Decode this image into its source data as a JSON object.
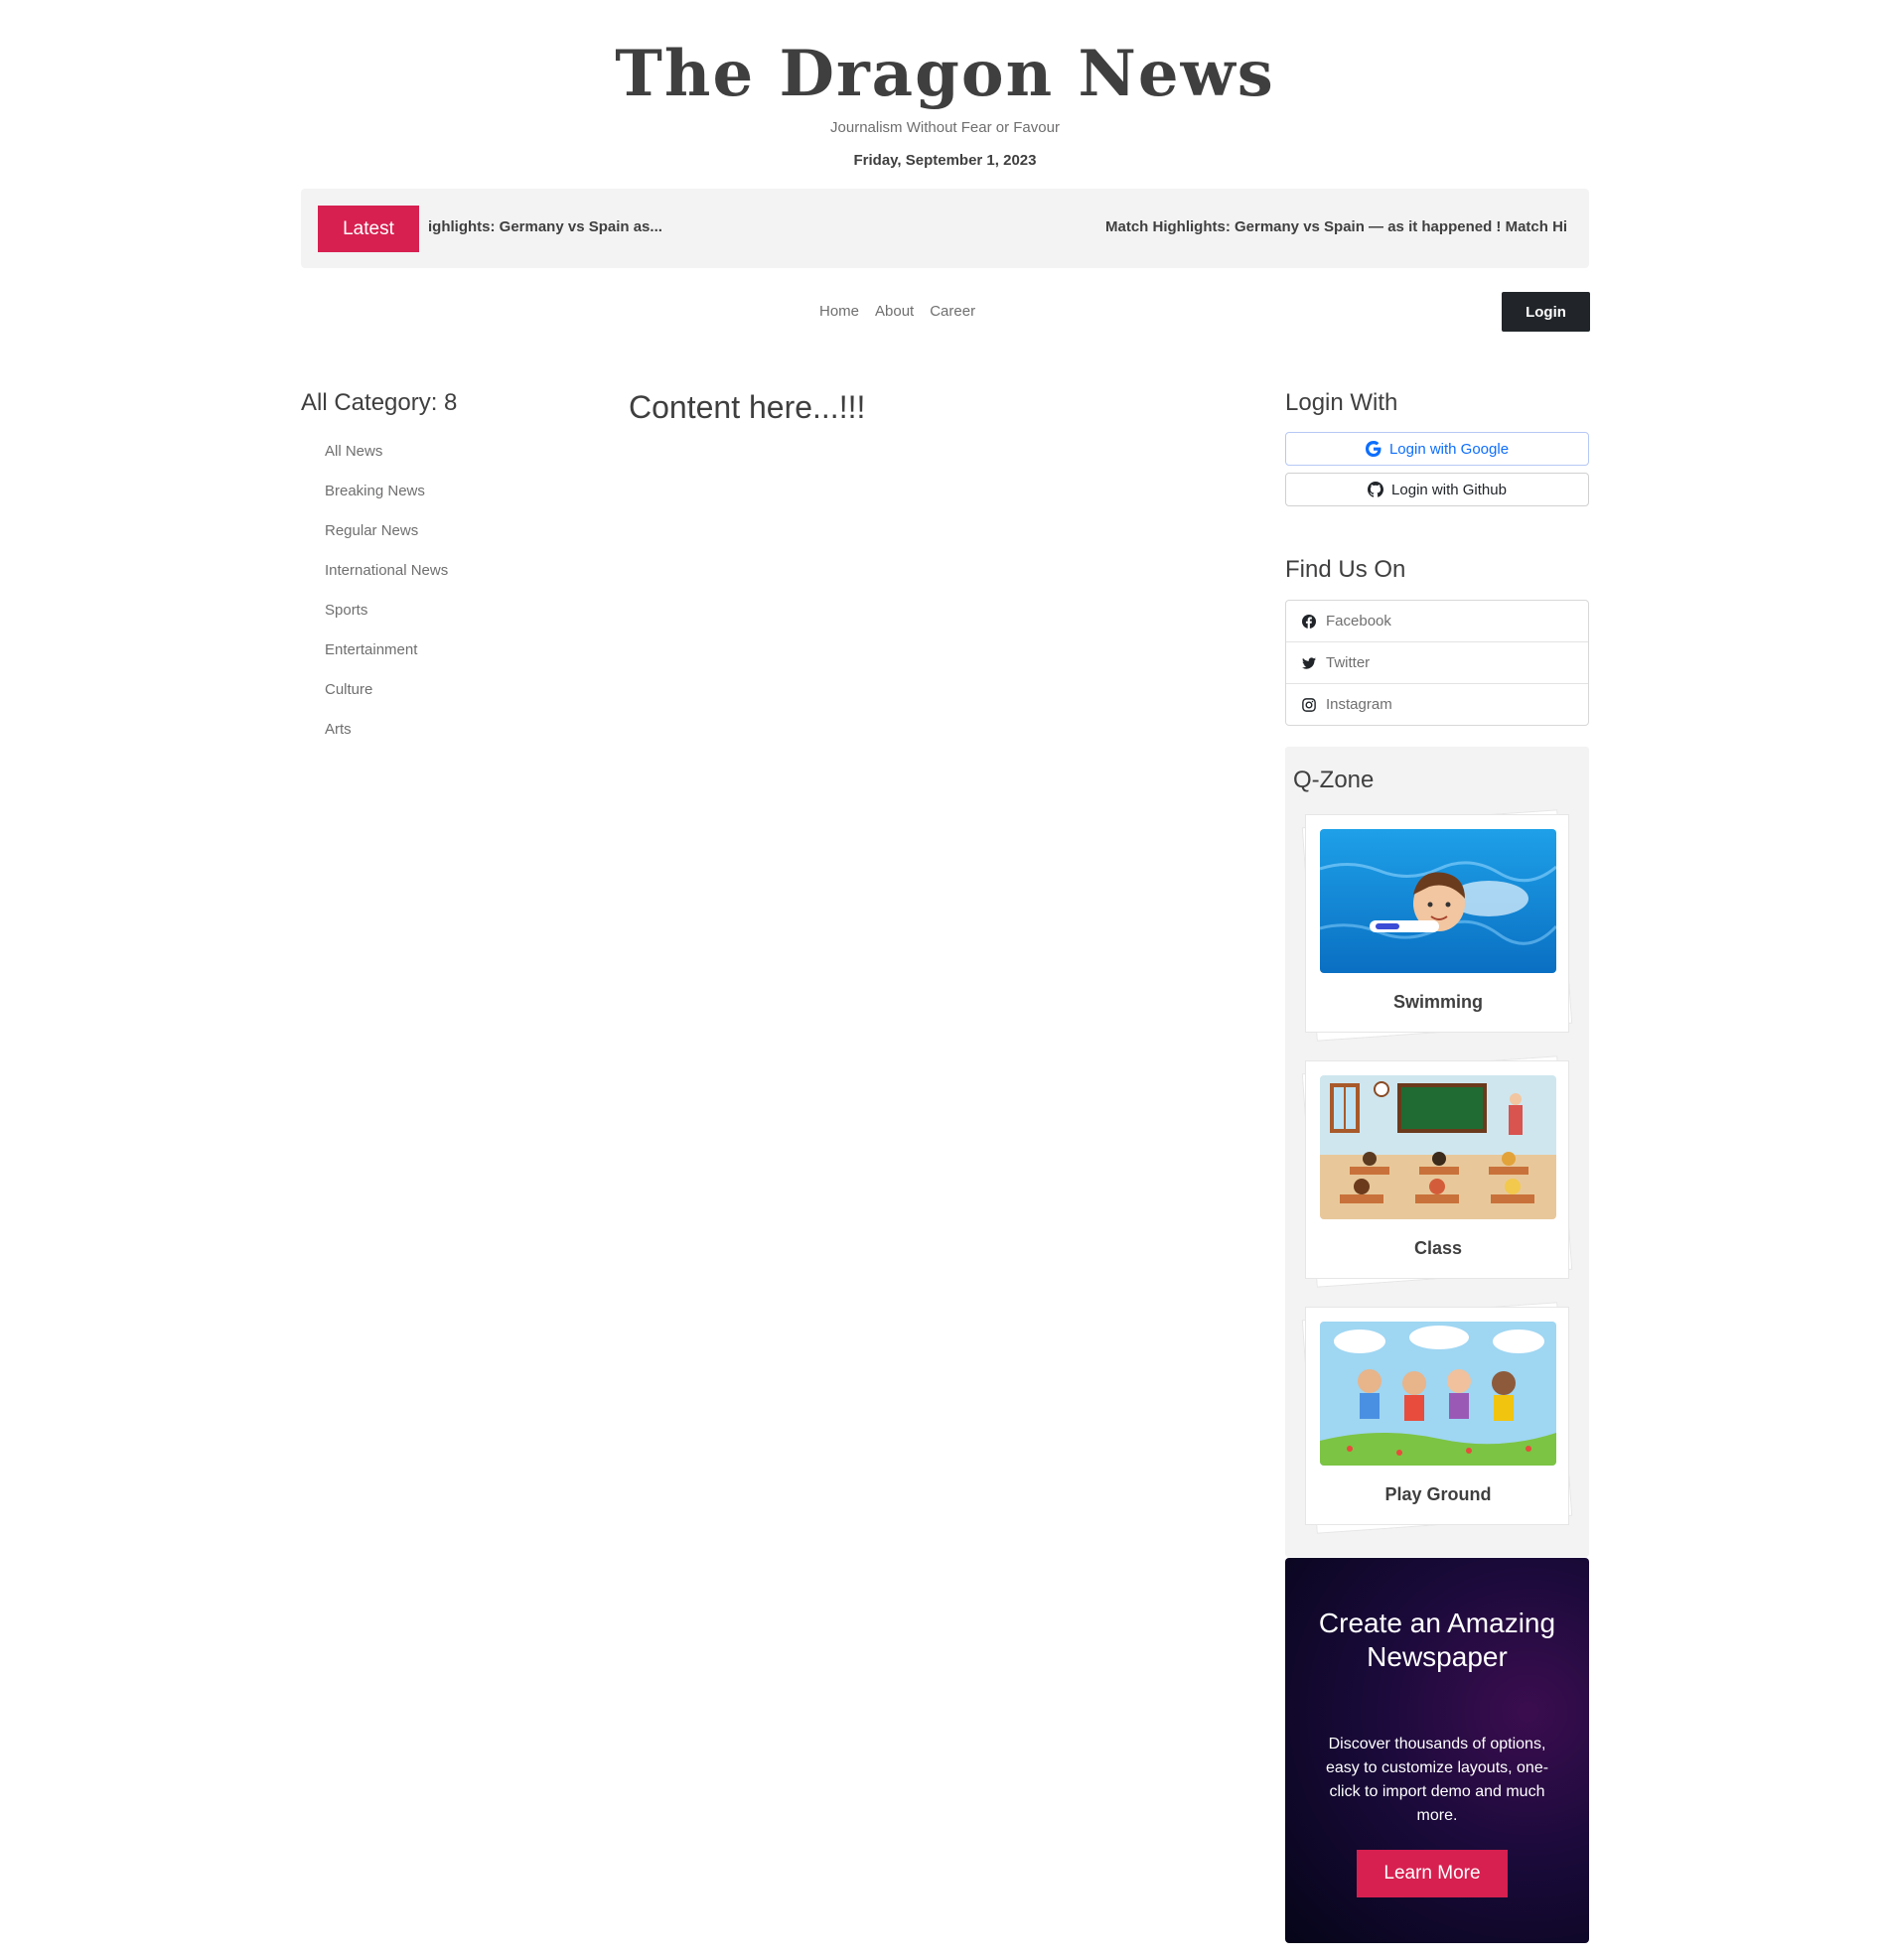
{
  "header": {
    "logo": "The Dragon News",
    "tagline": "Journalism Without Fear or Favour",
    "date": "Friday, September 1, 2023"
  },
  "ticker": {
    "button_label": "Latest",
    "text_1": "ighlights: Germany vs Spain as...",
    "text_2": "Match Highlights: Germany vs Spain — as it happened ! Match Hi"
  },
  "nav": {
    "items": [
      "Home",
      "About",
      "Career"
    ],
    "login_label": "Login"
  },
  "categories": {
    "title": "All Category: 8",
    "items": [
      "All News",
      "Breaking News",
      "Regular News",
      "International News",
      "Sports",
      "Entertainment",
      "Culture",
      "Arts"
    ]
  },
  "main": {
    "content_title": "Content here...!!!"
  },
  "login_with": {
    "title": "Login With",
    "google_label": "Login with Google",
    "github_label": "Login with Github"
  },
  "find_us": {
    "title": "Find Us On",
    "items": [
      {
        "label": "Facebook",
        "icon": "facebook-icon"
      },
      {
        "label": "Twitter",
        "icon": "twitter-icon"
      },
      {
        "label": "Instagram",
        "icon": "instagram-icon"
      }
    ]
  },
  "qzone": {
    "title": "Q-Zone",
    "cards": [
      {
        "label": "Swimming"
      },
      {
        "label": "Class"
      },
      {
        "label": "Play Ground"
      }
    ]
  },
  "promo": {
    "title": "Create an Amazing Newspaper",
    "text": "Discover thousands of options, easy to customize layouts, one-click to import demo and much more.",
    "button_label": "Learn More"
  },
  "colors": {
    "accent": "#d72050",
    "dark": "#403f3f",
    "muted": "#706f6f",
    "ticker_bg": "#f3f3f3",
    "google_blue": "#0d6efd"
  }
}
